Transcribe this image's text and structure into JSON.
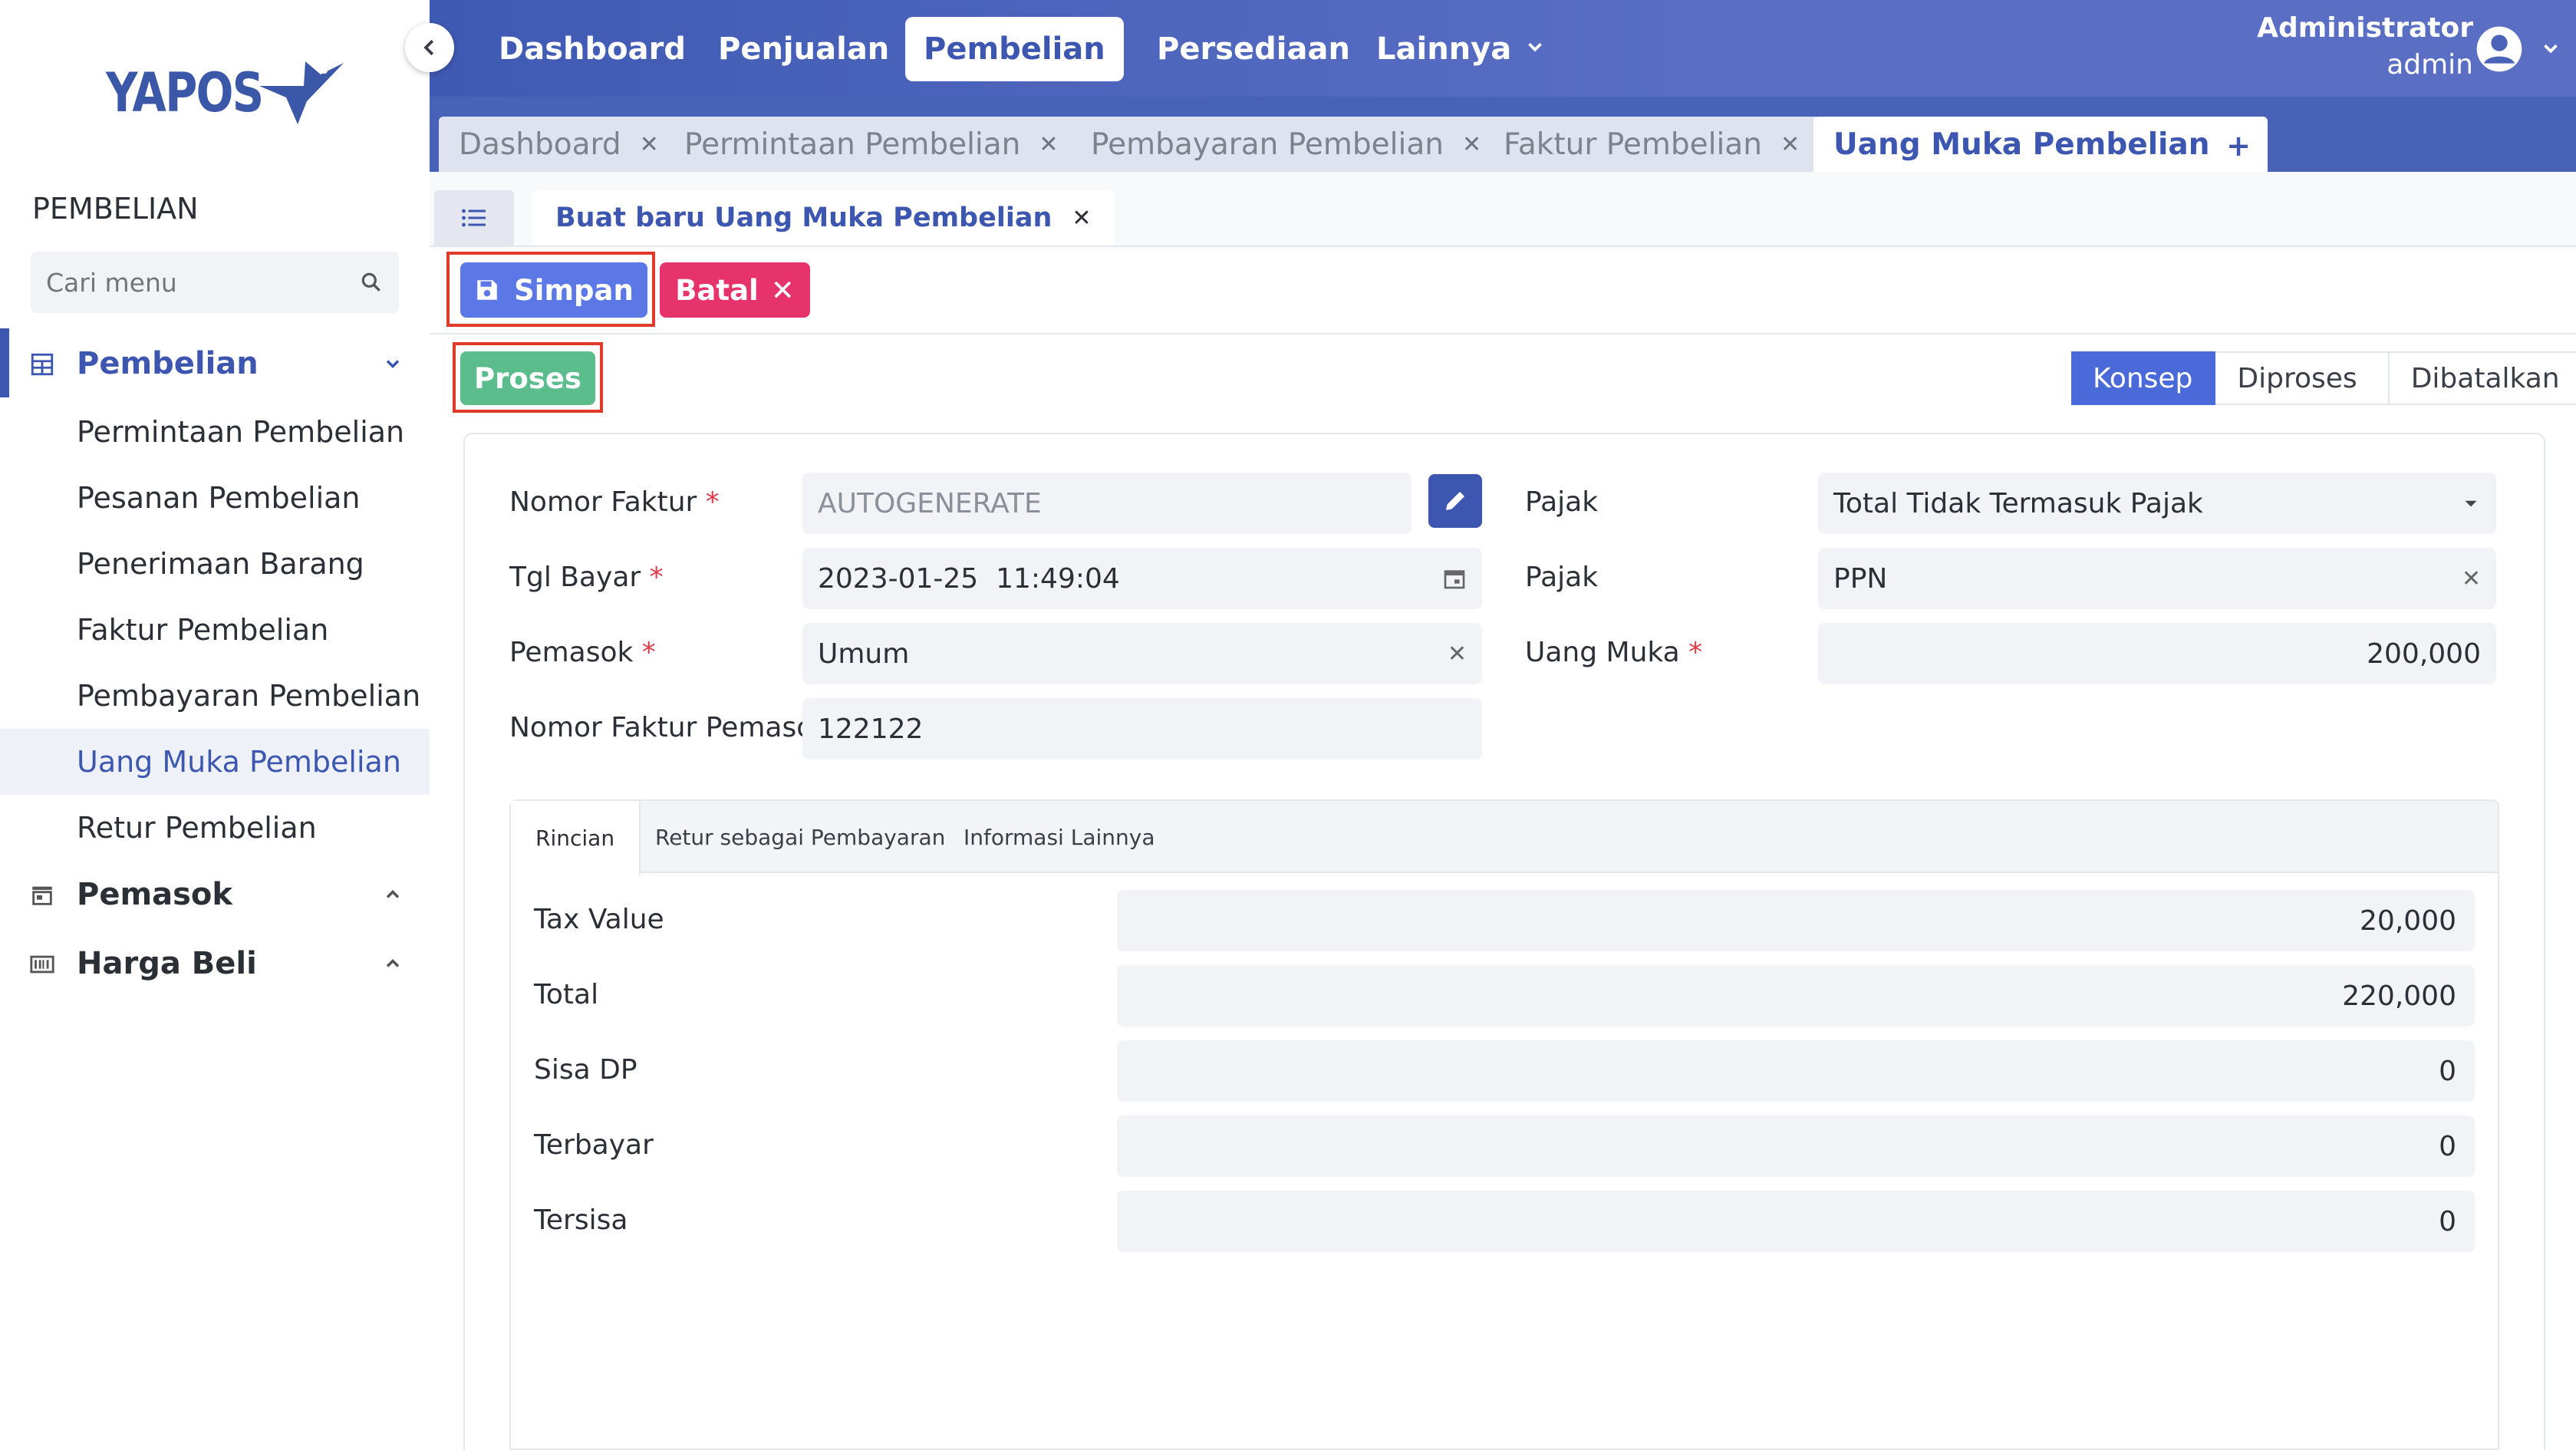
{
  "brand": {
    "logo_text": "YAPOS"
  },
  "sidebar": {
    "section_title": "PEMBELIAN",
    "search_placeholder": "Cari menu",
    "groups": [
      {
        "label": "Pembelian",
        "icon": "table-icon",
        "expanded": true
      },
      {
        "label": "Pemasok",
        "icon": "store-icon",
        "expanded": false
      },
      {
        "label": "Harga Beli",
        "icon": "barcode-icon",
        "expanded": false
      }
    ],
    "items": [
      "Permintaan Pembelian",
      "Pesanan Pembelian",
      "Penerimaan Barang",
      "Faktur Pembelian",
      "Pembayaran Pembelian",
      "Uang Muka Pembelian",
      "Retur Pembelian"
    ],
    "active_item": "Uang Muka Pembelian"
  },
  "topnav": {
    "items": [
      "Dashboard",
      "Penjualan",
      "Pembelian",
      "Persediaan",
      "Lainnya"
    ],
    "active": "Pembelian",
    "user_name": "Administrator",
    "user_role": "admin"
  },
  "tabs": [
    "Dashboard",
    "Permintaan Pembelian",
    "Pembayaran Pembelian",
    "Faktur Pembelian",
    "Uang Muka Pembelian"
  ],
  "active_tab": "Uang Muka Pembelian",
  "subtab": {
    "label": "Buat baru Uang Muka Pembelian"
  },
  "actions": {
    "save": "Simpan",
    "cancel": "Batal",
    "process": "Proses"
  },
  "status_steps": [
    "Konsep",
    "Diproses",
    "Dibatalkan"
  ],
  "active_status": "Konsep",
  "form": {
    "nomor_faktur": {
      "label": "Nomor Faktur",
      "value": "AUTOGENERATE"
    },
    "tgl_bayar": {
      "label": "Tgl Bayar",
      "value": "2023-01-25  11:49:04"
    },
    "pemasok": {
      "label": "Pemasok",
      "value": "Umum"
    },
    "nomor_faktur_pemasok": {
      "label": "Nomor Faktur Pemasok",
      "value": "122122"
    },
    "pajak_mode": {
      "label": "Pajak",
      "value": "Total Tidak Termasuk Pajak"
    },
    "pajak": {
      "label": "Pajak",
      "value": "PPN"
    },
    "uang_muka": {
      "label": "Uang Muka",
      "value": "200,000"
    }
  },
  "detail_tabs": [
    "Rincian",
    "Retur sebagai Pembayaran",
    "Informasi Lainnya"
  ],
  "details": {
    "tax_value": {
      "label": "Tax Value",
      "value": "20,000"
    },
    "total": {
      "label": "Total",
      "value": "220,000"
    },
    "sisa_dp": {
      "label": "Sisa DP",
      "value": "0"
    },
    "terbayar": {
      "label": "Terbayar",
      "value": "0"
    },
    "tersisa": {
      "label": "Tersisa",
      "value": "0"
    }
  },
  "colors": {
    "primary": "#3d57b0",
    "save": "#5b78e6",
    "cancel": "#e7336b",
    "process": "#5bbd8c",
    "highlight": "#e03b2a"
  }
}
